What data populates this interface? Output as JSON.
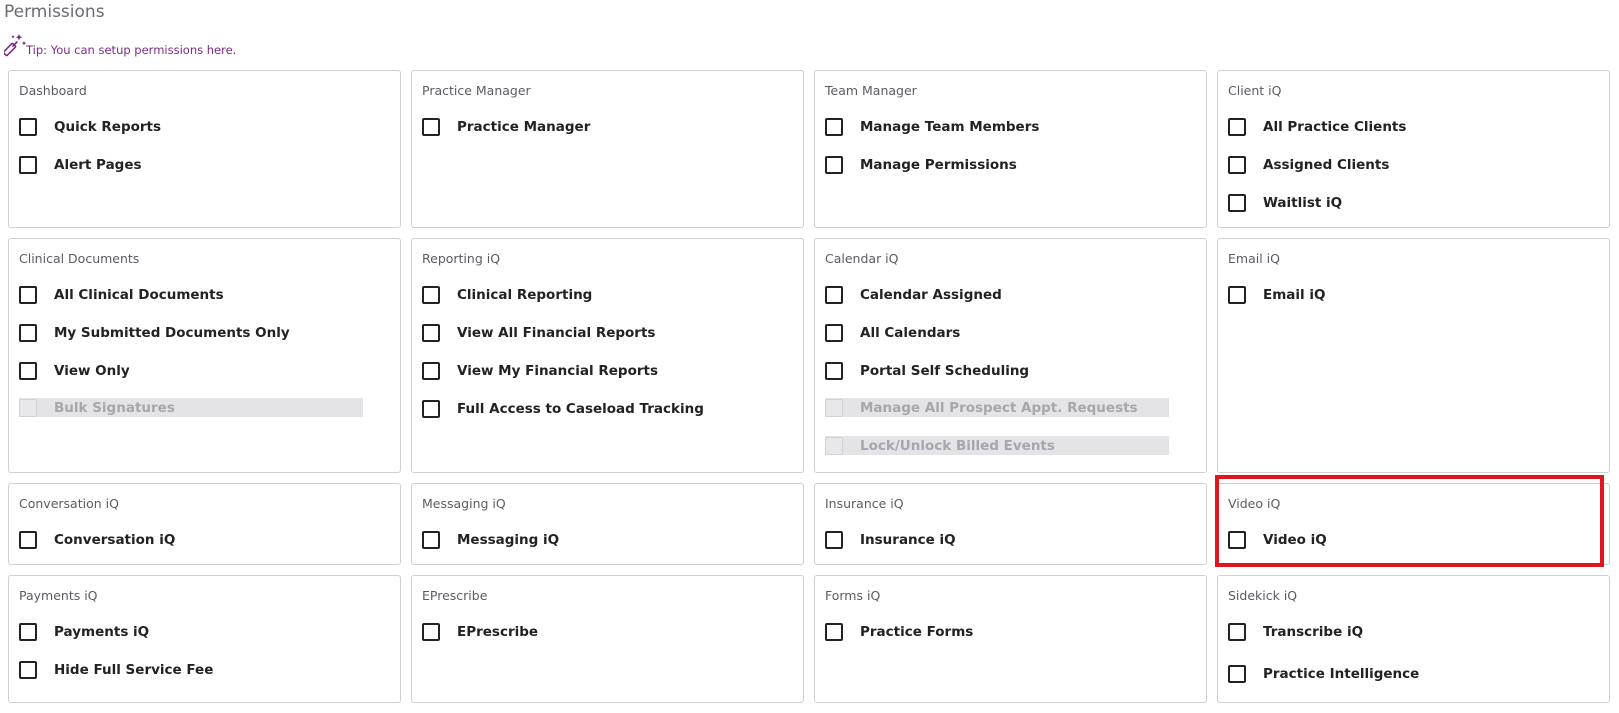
{
  "page": {
    "title": "Permissions",
    "tip": "Tip: You can setup permissions here."
  },
  "highlight_color": "#e0161e",
  "accent_color": "#7c2a86",
  "cards": [
    {
      "title": "Dashboard",
      "items": [
        {
          "label": "Quick Reports",
          "checked": false,
          "disabled": false
        },
        {
          "label": "Alert Pages",
          "checked": false,
          "disabled": false
        }
      ]
    },
    {
      "title": "Practice Manager",
      "items": [
        {
          "label": "Practice Manager",
          "checked": false,
          "disabled": false
        }
      ]
    },
    {
      "title": "Team Manager",
      "items": [
        {
          "label": "Manage Team Members",
          "checked": false,
          "disabled": false
        },
        {
          "label": "Manage Permissions",
          "checked": false,
          "disabled": false
        }
      ]
    },
    {
      "title": "Client iQ",
      "items": [
        {
          "label": "All Practice Clients",
          "checked": false,
          "disabled": false
        },
        {
          "label": "Assigned Clients",
          "checked": false,
          "disabled": false
        },
        {
          "label": "Waitlist iQ",
          "checked": false,
          "disabled": false
        }
      ]
    },
    {
      "title": "Clinical Documents",
      "items": [
        {
          "label": "All Clinical Documents",
          "checked": false,
          "disabled": false
        },
        {
          "label": "My Submitted Documents Only",
          "checked": false,
          "disabled": false
        },
        {
          "label": "View Only",
          "checked": false,
          "disabled": false
        },
        {
          "label": "Bulk Signatures",
          "checked": false,
          "disabled": true
        }
      ]
    },
    {
      "title": "Reporting iQ",
      "items": [
        {
          "label": "Clinical Reporting",
          "checked": false,
          "disabled": false
        },
        {
          "label": "View All Financial Reports",
          "checked": false,
          "disabled": false
        },
        {
          "label": "View My Financial Reports",
          "checked": false,
          "disabled": false
        },
        {
          "label": "Full Access to Caseload Tracking",
          "checked": false,
          "disabled": false
        }
      ]
    },
    {
      "title": "Calendar iQ",
      "items": [
        {
          "label": "Calendar Assigned",
          "checked": false,
          "disabled": false
        },
        {
          "label": "All Calendars",
          "checked": false,
          "disabled": false
        },
        {
          "label": "Portal Self Scheduling",
          "checked": false,
          "disabled": false
        },
        {
          "label": "Manage All Prospect Appt. Requests",
          "checked": false,
          "disabled": true
        },
        {
          "label": "Lock/Unlock Billed Events",
          "checked": false,
          "disabled": true
        }
      ]
    },
    {
      "title": "Email iQ",
      "items": [
        {
          "label": "Email iQ",
          "checked": false,
          "disabled": false
        }
      ]
    },
    {
      "title": "Conversation iQ",
      "items": [
        {
          "label": "Conversation iQ",
          "checked": false,
          "disabled": false
        }
      ]
    },
    {
      "title": "Messaging iQ",
      "items": [
        {
          "label": "Messaging iQ",
          "checked": false,
          "disabled": false
        }
      ]
    },
    {
      "title": "Insurance iQ",
      "items": [
        {
          "label": "Insurance iQ",
          "checked": false,
          "disabled": false
        }
      ]
    },
    {
      "title": "Video iQ",
      "items": [
        {
          "label": "Video iQ",
          "checked": false,
          "disabled": false
        }
      ]
    },
    {
      "title": "Payments iQ",
      "items": [
        {
          "label": "Payments iQ",
          "checked": false,
          "disabled": false
        },
        {
          "label": "Hide Full Service Fee",
          "checked": false,
          "disabled": false
        }
      ]
    },
    {
      "title": "EPrescribe",
      "items": [
        {
          "label": "EPrescribe",
          "checked": false,
          "disabled": false
        }
      ]
    },
    {
      "title": "Forms iQ",
      "items": [
        {
          "label": "Practice Forms",
          "checked": false,
          "disabled": false
        }
      ]
    },
    {
      "title": "Sidekick iQ",
      "items": [
        {
          "label": "Transcribe iQ",
          "checked": false,
          "disabled": false
        },
        {
          "label": "Practice Intelligence",
          "checked": false,
          "disabled": false
        }
      ]
    }
  ]
}
